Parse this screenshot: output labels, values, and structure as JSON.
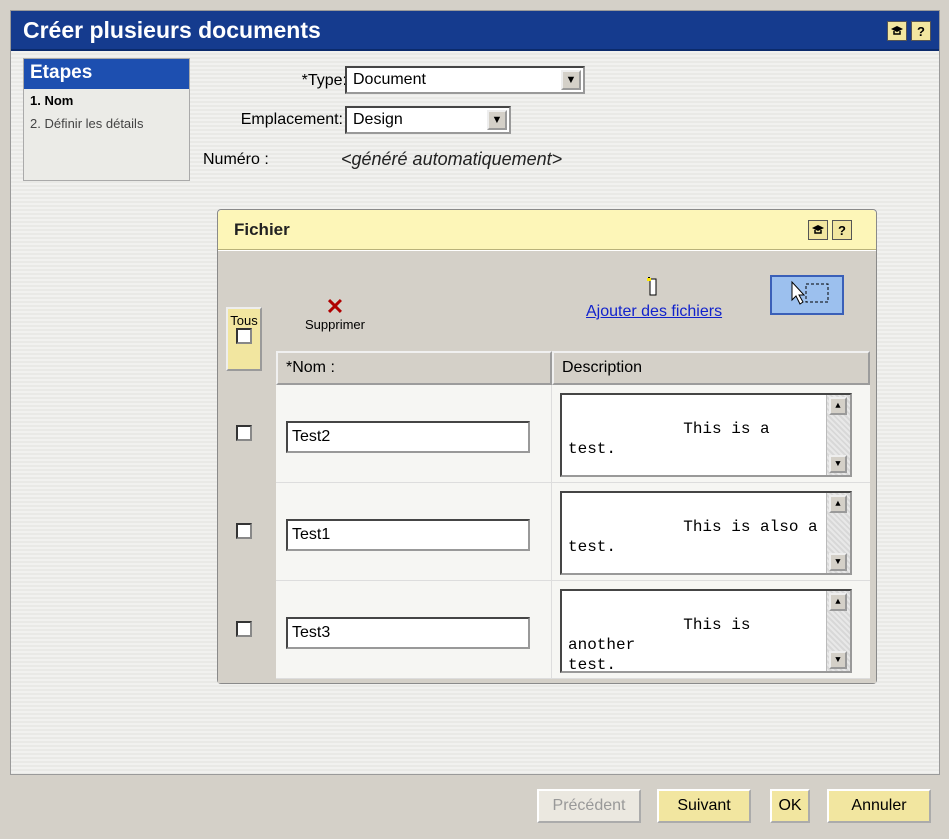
{
  "window": {
    "title": "Créer plusieurs documents"
  },
  "steps": {
    "header": "Etapes",
    "items": [
      {
        "label": "1. Nom",
        "active": true
      },
      {
        "label": "2. Définir les détails",
        "active": false
      }
    ]
  },
  "form": {
    "type_label": "*Type:",
    "type_value": "Document",
    "location_label": "Emplacement:",
    "location_value": "Design",
    "number_label": "Numéro :",
    "number_value": "<généré automatiquement>"
  },
  "panel": {
    "title": "Fichier",
    "all_label": "Tous",
    "delete_label": "Supprimer",
    "add_files_label": "Ajouter des fichiers",
    "columns": {
      "name": "*Nom :",
      "description": "Description"
    },
    "rows": [
      {
        "name": "Test2",
        "description": "This is a test."
      },
      {
        "name": "Test1",
        "description": "This is also a test."
      },
      {
        "name": "Test3",
        "description": "This is another\ntest."
      }
    ]
  },
  "buttons": {
    "previous": "Précédent",
    "next": "Suivant",
    "ok": "OK",
    "cancel": "Annuler"
  },
  "icons": {
    "help": "?",
    "tutor": "graduation-cap-icon"
  },
  "colors": {
    "titlebar": "#153b8e",
    "steps_header": "#1d4fb0",
    "panel_header": "#fdf6b8",
    "button_yellow": "#f2e6a0",
    "link": "#1122cc"
  }
}
